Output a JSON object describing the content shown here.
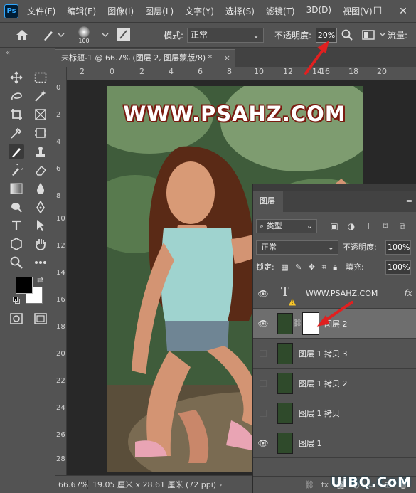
{
  "app": {
    "logo": "Ps"
  },
  "menu": [
    "文件(F)",
    "编辑(E)",
    "图像(I)",
    "图层(L)",
    "文字(Y)",
    "选择(S)",
    "滤镜(T)",
    "3D(D)",
    "视图(V)"
  ],
  "window_controls": {
    "minimize": "—",
    "maximize": "☐",
    "close": "✕"
  },
  "options": {
    "brush_size": "100",
    "mode_label": "模式:",
    "mode_value": "正常",
    "opacity_label": "不透明度:",
    "opacity_value": "20%",
    "flow_label": "流量:"
  },
  "document_tab": {
    "title": "未标题-1 @ 66.7% (图层 2, 图层蒙版/8) *",
    "close": "×"
  },
  "toolbar": {
    "collapse": "«"
  },
  "rulers": {
    "horizontal": [
      "2",
      "0",
      "2",
      "4",
      "6",
      "8",
      "10",
      "12",
      "14",
      "16",
      "18",
      "20"
    ],
    "vertical": [
      "0",
      "2",
      "4",
      "6",
      "8",
      "10",
      "12",
      "14",
      "16",
      "18",
      "20",
      "22",
      "24",
      "26",
      "28"
    ]
  },
  "canvas": {
    "watermark": "WWW.PSAHZ.COM"
  },
  "status": {
    "zoom": "66.67%",
    "info": "19.05 厘米 x 28.61 厘米 (72 ppi)"
  },
  "layers_panel": {
    "tab": "图层",
    "menu": "≡",
    "filter_kind": "类型",
    "blend_mode": "正常",
    "opacity_label": "不透明度:",
    "opacity_value": "100%",
    "lock_label": "锁定:",
    "fill_label": "填充:",
    "fill_value": "100%",
    "layers": [
      {
        "name": "WWW.PSAHZ.COM",
        "visible": true,
        "type": "text",
        "fx": "fx"
      },
      {
        "name": "图层 2",
        "visible": true,
        "type": "masked",
        "selected": true
      },
      {
        "name": "图层 1 拷贝 3",
        "visible": false,
        "type": "image"
      },
      {
        "name": "图层 1 拷贝 2",
        "visible": false,
        "type": "image"
      },
      {
        "name": "图层 1 拷贝",
        "visible": false,
        "type": "image"
      },
      {
        "name": "图层 1",
        "visible": true,
        "type": "image"
      }
    ]
  },
  "site_watermark": "UiBQ.CoM",
  "colors": {
    "accent_arrow": "#e02020",
    "ui_bg": "#535353",
    "canvas_bg": "#282828"
  }
}
